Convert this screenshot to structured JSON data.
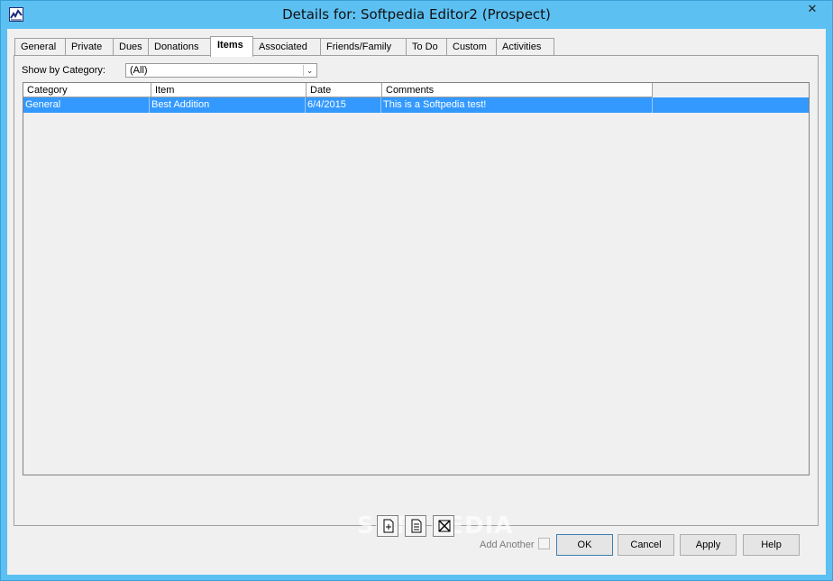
{
  "window": {
    "title": "Details for: Softpedia Editor2 (Prospect)",
    "close_glyph": "✕"
  },
  "tabs": [
    {
      "label": "General"
    },
    {
      "label": "Private"
    },
    {
      "label": "Dues"
    },
    {
      "label": "Donations"
    },
    {
      "label": "Items",
      "active": true
    },
    {
      "label": "Associated"
    },
    {
      "label": "Friends/Family"
    },
    {
      "label": "To Do"
    },
    {
      "label": "Custom"
    },
    {
      "label": "Activities"
    }
  ],
  "filter": {
    "label": "Show by Category:",
    "value": "(All)"
  },
  "grid": {
    "columns": [
      "Category",
      "Item",
      "Date",
      "Comments"
    ],
    "rows": [
      {
        "category": "General",
        "item": "Best Addition",
        "date": "6/4/2015",
        "comments": "This is a Softpedia test!",
        "selected": true
      }
    ]
  },
  "toolbar": {
    "icons": [
      "new-item-icon",
      "edit-item-icon",
      "delete-item-icon"
    ]
  },
  "watermark": "SOFTPEDIA",
  "footer": {
    "add_another_label": "Add Another",
    "add_another_checked": false,
    "ok_label": "OK",
    "cancel_label": "Cancel",
    "apply_label": "Apply",
    "help_label": "Help"
  },
  "colors": {
    "titlebar": "#5cc0f2",
    "selection": "#3399ff"
  }
}
